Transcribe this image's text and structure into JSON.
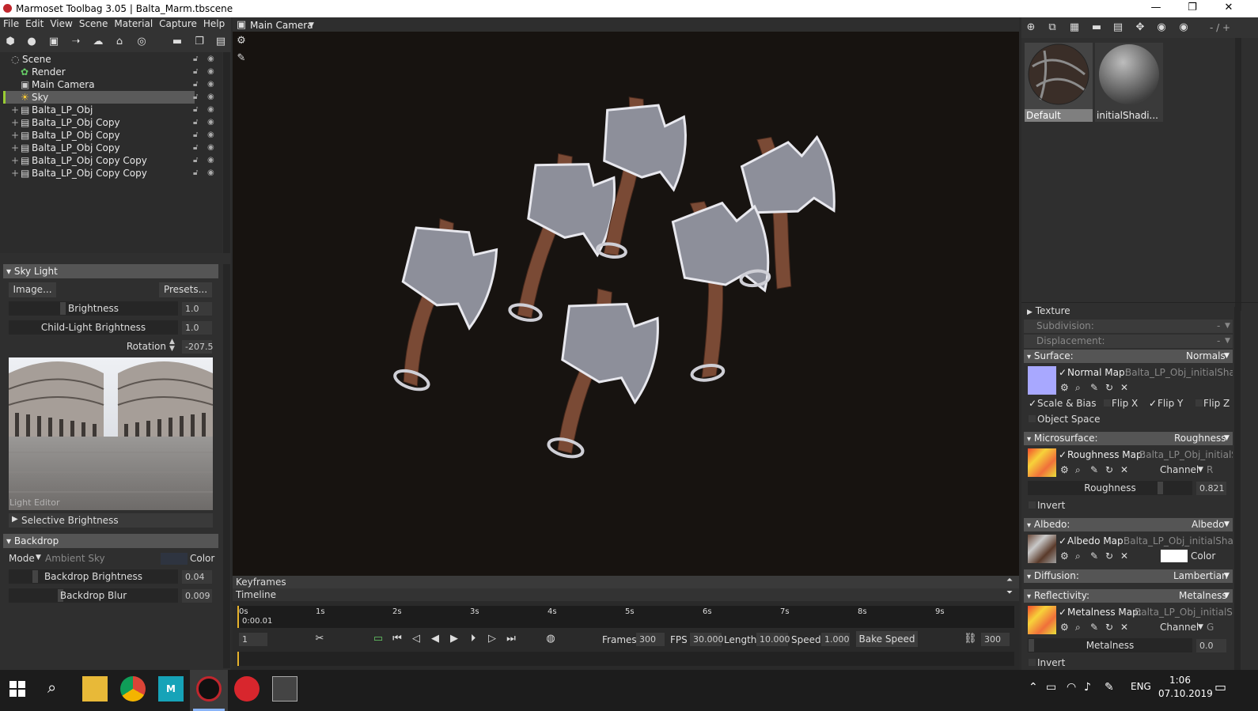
{
  "window": {
    "title": "Marmoset Toolbag 3.05  |  Balta_Marm.tbscene",
    "min": "—",
    "max": "❐",
    "close": "✕"
  },
  "menu": [
    "File",
    "Edit",
    "View",
    "Scene",
    "Material",
    "Capture",
    "Help"
  ],
  "viewport": {
    "camera": "Main Camera"
  },
  "scene_tree": [
    {
      "label": "Scene",
      "icon": "scene-icon"
    },
    {
      "label": "Render",
      "icon": "render-icon"
    },
    {
      "label": "Main Camera",
      "icon": "camera-icon"
    },
    {
      "label": "Sky",
      "icon": "sky-icon",
      "selected": true
    },
    {
      "label": "Balta_LP_Obj",
      "icon": "mesh-icon"
    },
    {
      "label": "Balta_LP_Obj Copy",
      "icon": "mesh-icon"
    },
    {
      "label": "Balta_LP_Obj Copy",
      "icon": "mesh-icon"
    },
    {
      "label": "Balta_LP_Obj Copy",
      "icon": "mesh-icon"
    },
    {
      "label": "Balta_LP_Obj Copy Copy",
      "icon": "mesh-icon"
    },
    {
      "label": "Balta_LP_Obj Copy Copy",
      "icon": "mesh-icon"
    }
  ],
  "sky_light": {
    "header": "Sky Light",
    "image_btn": "Image...",
    "presets_btn": "Presets...",
    "brightness_label": "Brightness",
    "brightness": "1.0",
    "child_label": "Child-Light Brightness",
    "child": "1.0",
    "rotation_label": "Rotation",
    "rotation": "-207.5",
    "light_editor": "Light Editor",
    "selective": "Selective Brightness"
  },
  "backdrop": {
    "header": "Backdrop",
    "mode_label": "Mode",
    "mode_value": "Ambient Sky",
    "color_label": "Color",
    "brightness_label": "Backdrop Brightness",
    "brightness": "0.04",
    "blur_label": "Backdrop Blur",
    "blur": "0.009"
  },
  "timeline": {
    "keyframes": "Keyframes",
    "timeline": "Timeline",
    "ticks": [
      "0s",
      "1s",
      "2s",
      "3s",
      "4s",
      "5s",
      "6s",
      "7s",
      "8s",
      "9s"
    ],
    "current_time": "0:00.01",
    "frame": "1",
    "frames_label": "Frames",
    "frames": "300",
    "fps_label": "FPS",
    "fps": "30.000",
    "length_label": "Length",
    "length": "10.000",
    "speed_label": "Speed",
    "speed": "1.000",
    "bake_label": "Bake Speed",
    "bake": "300"
  },
  "materials": {
    "ratio": "- / +",
    "items": [
      {
        "name": "Default"
      },
      {
        "name": "initialShadi..."
      }
    ]
  },
  "material_props": {
    "texture": "Texture",
    "subdivision": "Subdivision:",
    "subdivision_val": "-",
    "displacement": "Displacement:",
    "displacement_val": "-",
    "surface": "Surface:",
    "surface_val": "Normals",
    "normal_map": "Normal Map:",
    "normal_map_file": "Balta_LP_Obj_initialShadin",
    "scale_bias": "Scale & Bias",
    "flip_x": "Flip X",
    "flip_y": "Flip Y",
    "flip_z": "Flip Z",
    "object_space": "Object Space",
    "microsurface": "Microsurface:",
    "microsurface_val": "Roughness",
    "rough_map": "Roughness Map:",
    "rough_map_file": "Balta_LP_Obj_initialSha",
    "channel_label": "Channel",
    "rough_channel": "R",
    "roughness_label": "Roughness",
    "roughness": "0.821",
    "invert": "Invert",
    "albedo": "Albedo:",
    "albedo_val": "Albedo",
    "albedo_map": "Albedo Map:",
    "albedo_map_file": "Balta_LP_Obj_initialShadin",
    "color_label": "Color",
    "diffusion": "Diffusion:",
    "diffusion_val": "Lambertian",
    "reflectivity": "Reflectivity:",
    "reflectivity_val": "Metalness",
    "metal_map": "Metalness Map:",
    "metal_map_file": "Balta_LP_Obj_initialShac",
    "metal_channel": "G",
    "metalness_label": "Metalness",
    "metalness": "0.0",
    "invert2": "Invert"
  },
  "taskbar": {
    "lang": "ENG",
    "time": "1:06",
    "date": "07.10.2019"
  },
  "colors": {
    "accent": "#5a5a5a",
    "viewport_bg": "#171310",
    "panel": "#2f2f2f",
    "section_header": "#555555"
  }
}
